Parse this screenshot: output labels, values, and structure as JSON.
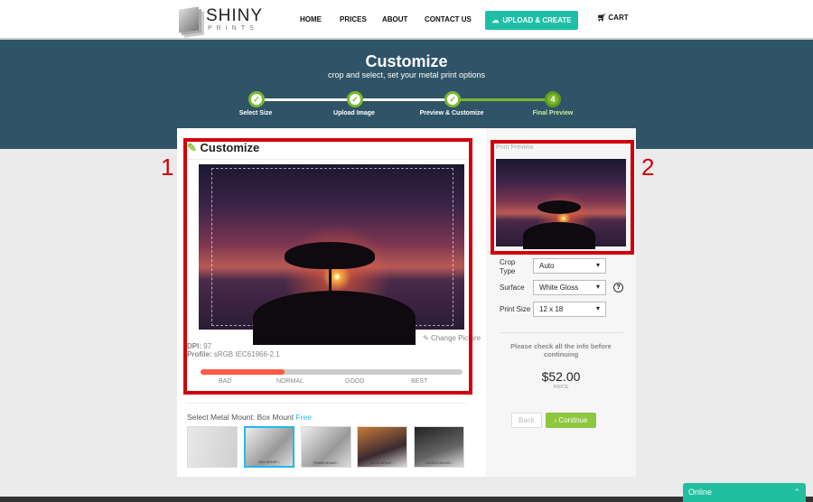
{
  "header": {
    "logo_main": "SHINY",
    "logo_sub": "PRINTS",
    "nav": [
      "HOME",
      "PRICES",
      "ABOUT",
      "CONTACT US"
    ],
    "upload_label": "UPLOAD & CREATE",
    "cart_label": "CART"
  },
  "banner": {
    "title": "Customize",
    "subtitle": "crop and select, set your metal print options",
    "steps": [
      {
        "label": "Select Size",
        "mark": "✓"
      },
      {
        "label": "Upload Image",
        "mark": "✓"
      },
      {
        "label": "Preview & Customize",
        "mark": "✓"
      },
      {
        "label": "Final Preview",
        "mark": "4"
      }
    ],
    "current_step": 4
  },
  "editor": {
    "heading": "Customize",
    "change_picture": "Change Picture",
    "dpi_label": "DPI:",
    "dpi": "97",
    "profile_label": "Profile:",
    "profile": "sRGB IEC61966-2.1",
    "quality_levels": [
      "BAD",
      "NORMAL",
      "GOOD",
      "BEST"
    ],
    "quality_fill_percent": 32
  },
  "mount": {
    "label": "Select Metal Mount:",
    "selected": "Box Mount",
    "price": "Free",
    "options": [
      "",
      "BOX MOUNT ›",
      "FRAME MOUNT ›",
      "EDGE MOUNT ›",
      "TUXEDO MOUNT ›"
    ]
  },
  "preview": {
    "label": "Print Preview",
    "crop_type_label": "Crop Type",
    "crop_type": "Auto",
    "surface_label": "Surface",
    "surface": "White Gloss",
    "size_label": "Print Size",
    "size": "12 x 18",
    "notice": "Please check all the info before continuing",
    "price": "$52.00",
    "price_label": "PRICE",
    "back": "Back",
    "continue": "Continue"
  },
  "annotations": [
    "1",
    "2"
  ],
  "chat": {
    "label": "Online"
  },
  "colors": {
    "accent": "#1fbfa7",
    "banner": "#2f5468",
    "green": "#8dc63f",
    "highlight": "#d0000a"
  }
}
